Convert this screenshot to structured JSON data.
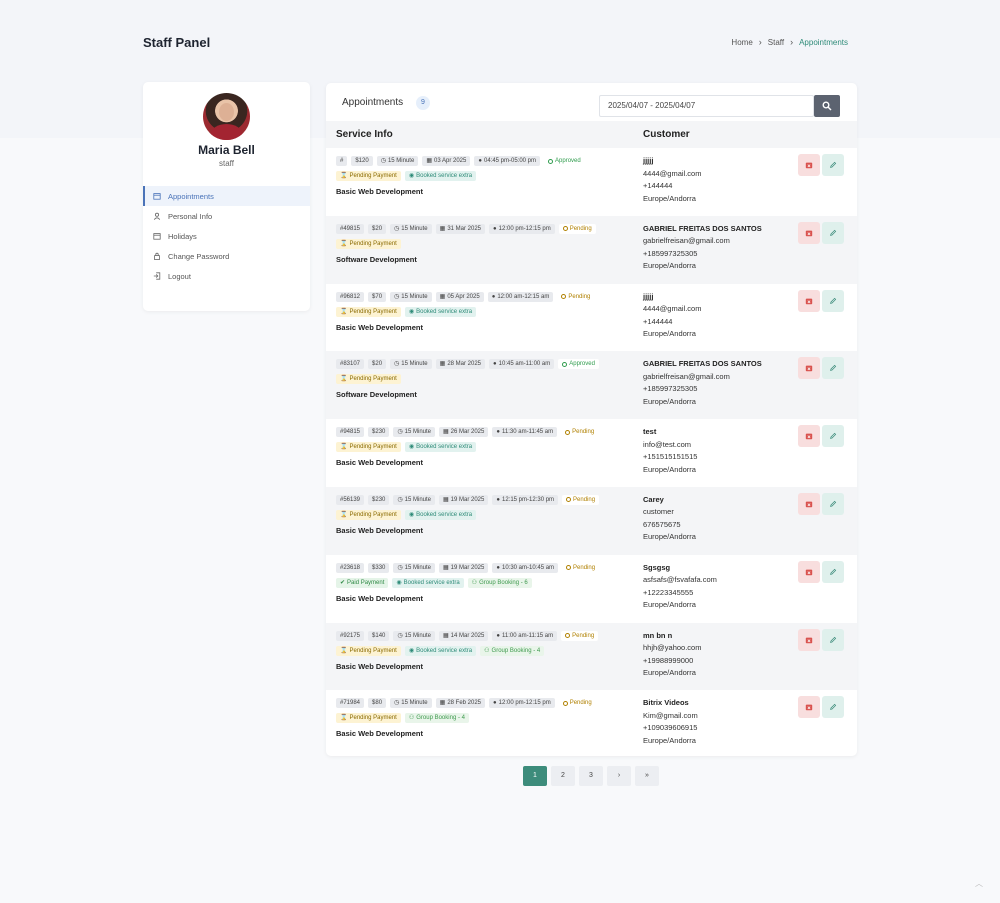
{
  "header": {
    "title": "Staff Panel",
    "breadcrumb": [
      "Home",
      "Staff",
      "Appointments"
    ]
  },
  "profile": {
    "name": "Maria Bell",
    "role": "staff"
  },
  "sidebar": {
    "items": [
      {
        "label": "Appointments",
        "icon": "calendar-icon",
        "active": true
      },
      {
        "label": "Personal Info",
        "icon": "user-icon",
        "active": false
      },
      {
        "label": "Holidays",
        "icon": "calendar-icon",
        "active": false
      },
      {
        "label": "Change Password",
        "icon": "lock-icon",
        "active": false
      },
      {
        "label": "Logout",
        "icon": "logout-icon",
        "active": false
      }
    ]
  },
  "main": {
    "title": "Appointments",
    "count": "9",
    "date_range": "2025/04/07 - 2025/04/07",
    "columns": [
      "Service Info",
      "Customer"
    ]
  },
  "appointments": [
    {
      "id": "#",
      "price": "$120",
      "duration": "15 Minute",
      "date": "03 Apr 2025",
      "time": "04:45 pm-05:00 pm",
      "status": "Approved",
      "tags": [
        "Pending Payment",
        "Booked service extra"
      ],
      "service": "Basic Web Development",
      "cname": "jjjjj",
      "cemail": "4444@gmail.com",
      "cphone": "+144444",
      "ctz": "Europe/Andorra"
    },
    {
      "id": "#49815",
      "price": "$20",
      "duration": "15 Minute",
      "date": "31 Mar 2025",
      "time": "12:00 pm-12:15 pm",
      "status": "Pending",
      "tags": [
        "Pending Payment"
      ],
      "service": "Software Development",
      "cname": "GABRIEL FREITAS DOS SANTOS",
      "cemail": "gabrielfreisan@gmail.com",
      "cphone": "+185997325305",
      "ctz": "Europe/Andorra"
    },
    {
      "id": "#96812",
      "price": "$70",
      "duration": "15 Minute",
      "date": "05 Apr 2025",
      "time": "12:00 am-12:15 am",
      "status": "Pending",
      "tags": [
        "Pending Payment",
        "Booked service extra"
      ],
      "service": "Basic Web Development",
      "cname": "jjjjj",
      "cemail": "4444@gmail.com",
      "cphone": "+144444",
      "ctz": "Europe/Andorra"
    },
    {
      "id": "#83107",
      "price": "$20",
      "duration": "15 Minute",
      "date": "28 Mar 2025",
      "time": "10:45 am-11:00 am",
      "status": "Approved",
      "tags": [
        "Pending Payment"
      ],
      "service": "Software Development",
      "cname": "GABRIEL FREITAS DOS SANTOS",
      "cemail": "gabrielfreisan@gmail.com",
      "cphone": "+185997325305",
      "ctz": "Europe/Andorra"
    },
    {
      "id": "#94815",
      "price": "$230",
      "duration": "15 Minute",
      "date": "26 Mar 2025",
      "time": "11:30 am-11:45 am",
      "status": "Pending",
      "tags": [
        "Pending Payment",
        "Booked service extra"
      ],
      "service": "Basic Web Development",
      "cname": "test",
      "cemail": "info@test.com",
      "cphone": "+151515151515",
      "ctz": "Europe/Andorra"
    },
    {
      "id": "#56139",
      "price": "$230",
      "duration": "15 Minute",
      "date": "19 Mar 2025",
      "time": "12:15 pm-12:30 pm",
      "status": "Pending",
      "tags": [
        "Pending Payment",
        "Booked service extra"
      ],
      "service": "Basic Web Development",
      "cname": "Carey",
      "cemail": "customer",
      "cphone": "676575675",
      "ctz": "Europe/Andorra"
    },
    {
      "id": "#23618",
      "price": "$330",
      "duration": "15 Minute",
      "date": "19 Mar 2025",
      "time": "10:30 am-10:45 am",
      "status": "Pending",
      "tags": [
        "Paid Payment",
        "Booked service extra",
        "Group Booking - 6"
      ],
      "service": "Basic Web Development",
      "cname": "Sgsgsg",
      "cemail": "asfsafs@fsvafafa.com",
      "cphone": "+12223345555",
      "ctz": "Europe/Andorra"
    },
    {
      "id": "#92175",
      "price": "$140",
      "duration": "15 Minute",
      "date": "14 Mar 2025",
      "time": "11:00 am-11:15 am",
      "status": "Pending",
      "tags": [
        "Pending Payment",
        "Booked service extra",
        "Group Booking - 4"
      ],
      "service": "Basic Web Development",
      "cname": "mn bn n",
      "cemail": "hhjh@yahoo.com",
      "cphone": "+19988999000",
      "ctz": "Europe/Andorra"
    },
    {
      "id": "#71984",
      "price": "$80",
      "duration": "15 Minute",
      "date": "28 Feb 2025",
      "time": "12:00 pm-12:15 pm",
      "status": "Pending",
      "tags": [
        "Pending Payment",
        "Group Booking - 4"
      ],
      "service": "Basic Web Development",
      "cname": "Bitrix Videos",
      "cemail": "Kim@gmail.com",
      "cphone": "+109039606915",
      "ctz": "Europe/Andorra"
    }
  ],
  "pagination": [
    "1",
    "2",
    "3",
    "›",
    "»"
  ],
  "colors": {
    "accent": "#3d8c7b",
    "link": "#4a73b8",
    "danger_bg": "#f8dede",
    "success_bg": "#dff0ec"
  }
}
